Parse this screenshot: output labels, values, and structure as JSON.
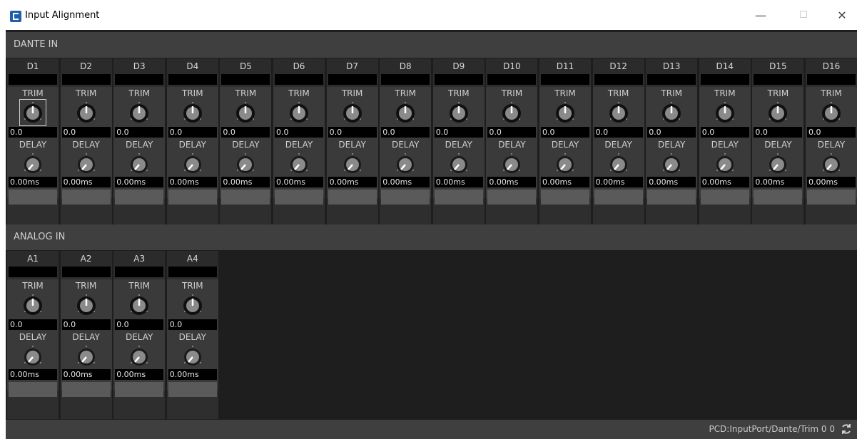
{
  "window": {
    "title": "Input Alignment"
  },
  "window_controls": {
    "minimize": "—",
    "maximize": "☐",
    "close": "✕"
  },
  "dante": {
    "header": "DANTE IN",
    "channels": [
      {
        "name": "D1",
        "trim_label": "TRIM",
        "trim_value": "0.0",
        "delay_label": "DELAY",
        "delay_value": "0.00ms"
      },
      {
        "name": "D2",
        "trim_label": "TRIM",
        "trim_value": "0.0",
        "delay_label": "DELAY",
        "delay_value": "0.00ms"
      },
      {
        "name": "D3",
        "trim_label": "TRIM",
        "trim_value": "0.0",
        "delay_label": "DELAY",
        "delay_value": "0.00ms"
      },
      {
        "name": "D4",
        "trim_label": "TRIM",
        "trim_value": "0.0",
        "delay_label": "DELAY",
        "delay_value": "0.00ms"
      },
      {
        "name": "D5",
        "trim_label": "TRIM",
        "trim_value": "0.0",
        "delay_label": "DELAY",
        "delay_value": "0.00ms"
      },
      {
        "name": "D6",
        "trim_label": "TRIM",
        "trim_value": "0.0",
        "delay_label": "DELAY",
        "delay_value": "0.00ms"
      },
      {
        "name": "D7",
        "trim_label": "TRIM",
        "trim_value": "0.0",
        "delay_label": "DELAY",
        "delay_value": "0.00ms"
      },
      {
        "name": "D8",
        "trim_label": "TRIM",
        "trim_value": "0.0",
        "delay_label": "DELAY",
        "delay_value": "0.00ms"
      },
      {
        "name": "D9",
        "trim_label": "TRIM",
        "trim_value": "0.0",
        "delay_label": "DELAY",
        "delay_value": "0.00ms"
      },
      {
        "name": "D10",
        "trim_label": "TRIM",
        "trim_value": "0.0",
        "delay_label": "DELAY",
        "delay_value": "0.00ms"
      },
      {
        "name": "D11",
        "trim_label": "TRIM",
        "trim_value": "0.0",
        "delay_label": "DELAY",
        "delay_value": "0.00ms"
      },
      {
        "name": "D12",
        "trim_label": "TRIM",
        "trim_value": "0.0",
        "delay_label": "DELAY",
        "delay_value": "0.00ms"
      },
      {
        "name": "D13",
        "trim_label": "TRIM",
        "trim_value": "0.0",
        "delay_label": "DELAY",
        "delay_value": "0.00ms"
      },
      {
        "name": "D14",
        "trim_label": "TRIM",
        "trim_value": "0.0",
        "delay_label": "DELAY",
        "delay_value": "0.00ms"
      },
      {
        "name": "D15",
        "trim_label": "TRIM",
        "trim_value": "0.0",
        "delay_label": "DELAY",
        "delay_value": "0.00ms"
      },
      {
        "name": "D16",
        "trim_label": "TRIM",
        "trim_value": "0.0",
        "delay_label": "DELAY",
        "delay_value": "0.00ms"
      }
    ]
  },
  "analog": {
    "header": "ANALOG IN",
    "channels": [
      {
        "name": "A1",
        "trim_label": "TRIM",
        "trim_value": "0.0",
        "delay_label": "DELAY",
        "delay_value": "0.00ms"
      },
      {
        "name": "A2",
        "trim_label": "TRIM",
        "trim_value": "0.0",
        "delay_label": "DELAY",
        "delay_value": "0.00ms"
      },
      {
        "name": "A3",
        "trim_label": "TRIM",
        "trim_value": "0.0",
        "delay_label": "DELAY",
        "delay_value": "0.00ms"
      },
      {
        "name": "A4",
        "trim_label": "TRIM",
        "trim_value": "0.0",
        "delay_label": "DELAY",
        "delay_value": "0.00ms"
      }
    ]
  },
  "status": {
    "text": "PCD:InputPort/Dante/Trim 0 0",
    "icon": "refresh-icon"
  },
  "colors": {
    "background": "#1e1e1e",
    "header": "#3f3f3f",
    "strip": "#2e2e2e",
    "panel": "#3a3a3a",
    "value_box": "#000000",
    "accent_icon": "#1f5fae"
  }
}
